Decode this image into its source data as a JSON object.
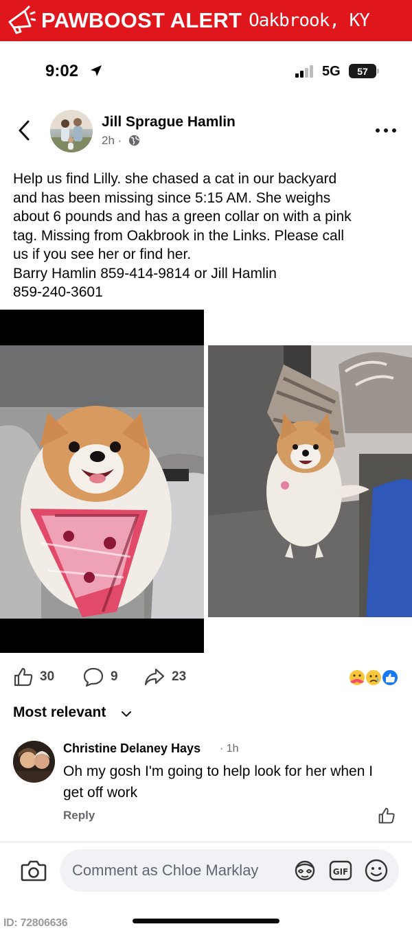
{
  "banner": {
    "title": "PAWBOOST ALERT",
    "location": "Oakbrook, KY",
    "icon": "megaphone-icon"
  },
  "status_bar": {
    "time": "9:02",
    "network": "5G",
    "battery": "57"
  },
  "post": {
    "author": "Jill Sprague Hamlin",
    "time": "2h ·",
    "text": "Help us find Lilly. she chased a cat in our backyard\nand has been missing since 5:15 AM. She weighs\nabout 6 pounds and has a green collar on with a pink\ntag. Missing from Oakbrook in the Links. Please call\nus if you see her or find her.\nBarry Hamlin 859-414-9814 or Jill Hamlin\n859-240-3601"
  },
  "actions": {
    "likes": "30",
    "comments": "9",
    "shares": "23"
  },
  "sort": {
    "label": "Most relevant"
  },
  "comment": {
    "name": "Christine Delaney Hays",
    "time": "· 1h",
    "text": "Oh my gosh I'm going to help look for her when I get off work",
    "reply": "Reply"
  },
  "composer": {
    "placeholder": "Comment as Chloe Marklay"
  },
  "footer": {
    "listing_id": "ID: 72806636"
  },
  "colors": {
    "banner_red": "#e0161d",
    "facebook_blue": "#1877f2"
  }
}
